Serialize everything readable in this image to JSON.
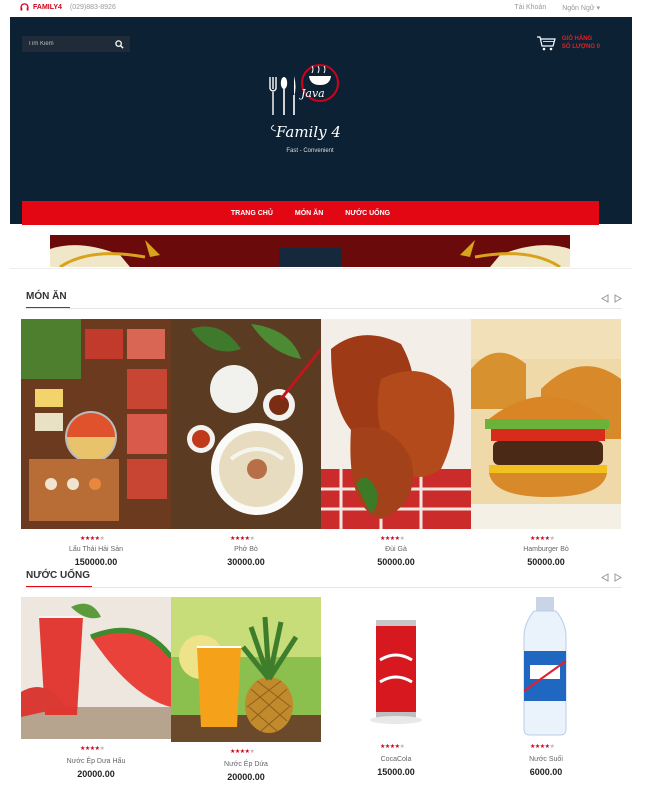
{
  "topbar": {
    "brand": "FAMILY4",
    "phone": "(029)883-8926",
    "account": "Tài Khoản",
    "language": "Ngôn Ngữ ▾"
  },
  "header": {
    "search_placeholder": "Tìm Kiếm",
    "cart_label": "GIỎ HÀNG",
    "cart_count": "SỐ LƯỢNG 0",
    "logo_text": "Java",
    "logo_script": "Family 4",
    "slogan": "Fast - Convenient"
  },
  "nav": {
    "items": [
      "TRANG CHỦ",
      "MÓN ĂN",
      "NƯỚC UỐNG"
    ]
  },
  "food": {
    "title": "MÓN ĂN",
    "products": [
      {
        "name": "Lẩu Thái Hải Sản",
        "price": "150000.00",
        "rating": 4
      },
      {
        "name": "Phở Bò",
        "price": "30000.00",
        "rating": 4
      },
      {
        "name": "Đùi Gà",
        "price": "50000.00",
        "rating": 4
      },
      {
        "name": "Hamburger Bò",
        "price": "50000.00",
        "rating": 4
      }
    ]
  },
  "drinks": {
    "title": "NƯỚC UỐNG",
    "products": [
      {
        "name": "Nước Ép Dưa Hấu",
        "price": "20000.00",
        "rating": 4
      },
      {
        "name": "Nước Ép Dứa",
        "price": "20000.00",
        "rating": 4
      },
      {
        "name": "CocaCola",
        "price": "15000.00",
        "rating": 4
      },
      {
        "name": "Nước Suối",
        "price": "6000.00",
        "rating": 4
      }
    ]
  },
  "colors": {
    "accent": "#e30613",
    "header_bg": "#0d2135"
  }
}
